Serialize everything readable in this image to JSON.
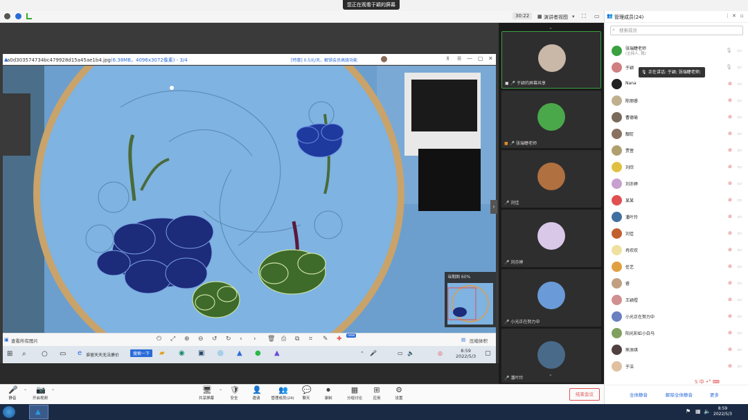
{
  "banner": {
    "label": "您正在观看于颖的屏幕"
  },
  "topbar": {
    "timer": "30:22",
    "view_label": "演讲者视图"
  },
  "viewer": {
    "file_name": "a0d303574734bc479928d15a45ae1b4.jpg",
    "file_info": "(6.38MB，4096x3072像素) - 3/4",
    "vip_text": "[特惠] 0.5元/天，解锁会员高级功能",
    "minimap_label": "当期图 60%",
    "bottom_left": "查看所有图片",
    "bottom_right": "压缩体积",
    "new_badge": "new"
  },
  "inner_taskbar": {
    "search_btn": "搜索一下",
    "search_text": "谁留天天无法廉价",
    "time": "8:59",
    "date": "2022/5/3"
  },
  "videos": [
    {
      "label": "于颖的屏幕共享",
      "color": "#c9b7a8"
    },
    {
      "label": "张瑞睫老师",
      "color": "#4aa84a"
    },
    {
      "label": "刘佳",
      "color": "#b07040"
    },
    {
      "label": "刘亦婷",
      "color": "#d9c8e8"
    },
    {
      "label": "小光正在努力中",
      "color": "#6a9ad8"
    },
    {
      "label": "潘叶玲",
      "color": "#4a6a8a"
    }
  ],
  "panel": {
    "title": "管理成员(24)",
    "search_placeholder": "搜索成员",
    "speaking": "正在讲话: 于颖; 张瑞睫老师;",
    "members": [
      {
        "name": "张瑞睫老师",
        "sub": "(主持人, 我)",
        "color": "#3aa040"
      },
      {
        "name": "于颖",
        "sub": "",
        "color": "#d08080"
      },
      {
        "name": "Nana",
        "sub": "",
        "color": "#222"
      },
      {
        "name": "陈丽睿",
        "sub": "",
        "color": "#c0b090"
      },
      {
        "name": "曹德瑜",
        "sub": "",
        "color": "#7a6a5a"
      },
      {
        "name": "靓耵",
        "sub": "",
        "color": "#8a7060"
      },
      {
        "name": "贾萱",
        "sub": "",
        "color": "#b0a070"
      },
      {
        "name": "刘欣",
        "sub": "",
        "color": "#e0c040"
      },
      {
        "name": "刘亦婷",
        "sub": "",
        "color": "#c8a0d0"
      },
      {
        "name": "某某",
        "sub": "",
        "color": "#e05050"
      },
      {
        "name": "潘叶玲",
        "sub": "",
        "color": "#4070a0"
      },
      {
        "name": "刘佳",
        "sub": "",
        "color": "#c06030"
      },
      {
        "name": "冉欢欢",
        "sub": "",
        "color": "#f0e0a0"
      },
      {
        "name": "任艺",
        "sub": "",
        "color": "#e0a040"
      },
      {
        "name": "睿",
        "sub": "",
        "color": "#c0a080"
      },
      {
        "name": "王颖煜",
        "sub": "",
        "color": "#d09090"
      },
      {
        "name": "小光正在努力中",
        "sub": "",
        "color": "#6a80c0"
      },
      {
        "name": "阳光彩虹小白马",
        "sub": "",
        "color": "#80a060"
      },
      {
        "name": "熊添琪",
        "sub": "",
        "color": "#504040"
      },
      {
        "name": "于洁",
        "sub": "",
        "color": "#e0c0a0"
      }
    ],
    "mute_all": "全体静音",
    "unmute_all": "解除全体静音",
    "more": "更多"
  },
  "toolbar": {
    "left": [
      {
        "label": "静音",
        "icon": "🎤"
      },
      {
        "label": "开启视频",
        "icon": "📷"
      }
    ],
    "center": [
      {
        "label": "共享屏幕",
        "icon": "🖥"
      },
      {
        "label": "安全",
        "icon": "🛡"
      },
      {
        "label": "邀请",
        "icon": "👤"
      },
      {
        "label": "管理成员(24)",
        "icon": "👥"
      },
      {
        "label": "聊天",
        "icon": "💬"
      },
      {
        "label": "录制",
        "icon": "⏺"
      },
      {
        "label": "分组讨论",
        "icon": "▦"
      },
      {
        "label": "应用",
        "icon": "⊞"
      },
      {
        "label": "设置",
        "icon": "⚙"
      }
    ],
    "end_meeting": "结束会议"
  },
  "clock": {
    "time": "8:59",
    "date": "2022/5/3"
  }
}
